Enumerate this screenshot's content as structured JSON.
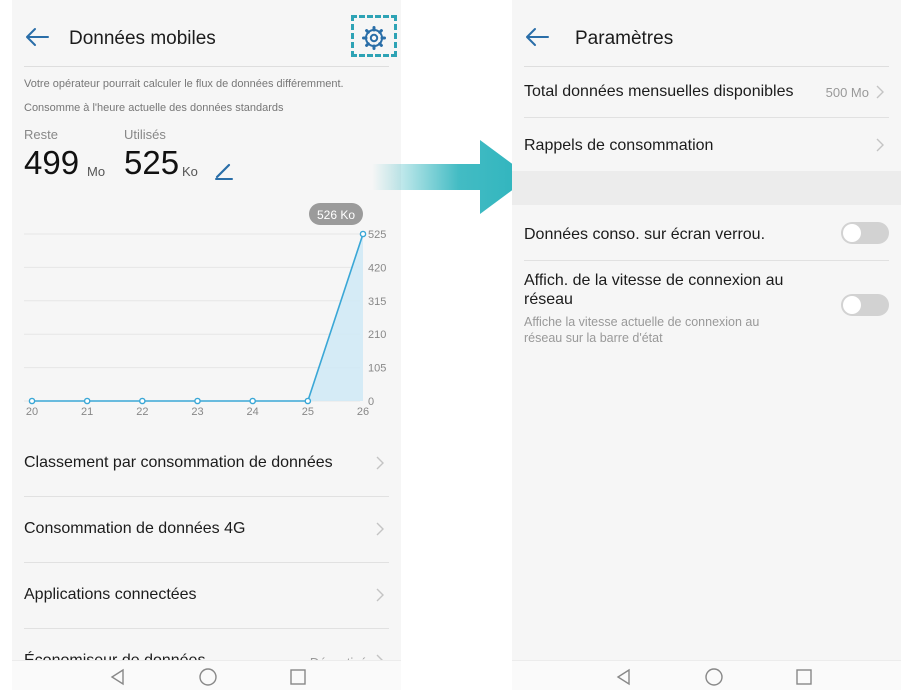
{
  "left": {
    "title": "Données mobiles",
    "note1": "Votre opérateur pourrait calculer le flux de données différemment.",
    "note2": "Consomme à l'heure actuelle des données standards",
    "remaining_label": "Reste",
    "remaining_value": "499",
    "remaining_unit": "Mo",
    "used_label": "Utilisés",
    "used_value": "525",
    "used_unit": "Ko",
    "rows": [
      {
        "label": "Classement par consommation de données"
      },
      {
        "label": "Consommation de données 4G"
      },
      {
        "label": "Applications connectées"
      },
      {
        "label": "Économiseur de données",
        "value": "Désactivé"
      }
    ]
  },
  "right": {
    "title": "Paramètres",
    "rows": [
      {
        "label": "Total données mensuelles disponibles",
        "value": "500 Mo"
      },
      {
        "label": "Rappels de consommation"
      }
    ],
    "lock_screen": {
      "label": "Données conso. sur écran verrou.",
      "on": false
    },
    "speed": {
      "label_line1": "Affich. de la vitesse de connexion au",
      "label_line2": "réseau",
      "desc_line1": "Affiche la vitesse actuelle de connexion au",
      "desc_line2": "réseau sur la barre d'état",
      "on": false
    }
  },
  "icons": [
    "back-icon",
    "gear-icon",
    "edit-icon",
    "chevron-right-icon",
    "nav-back-icon",
    "nav-home-icon",
    "nav-recent-icon"
  ],
  "colors": {
    "accent": "#2ea3b5",
    "chart_line": "#3aa7d6",
    "chart_fill": "#cfe9f6"
  },
  "chart_data": {
    "type": "area",
    "x": [
      20,
      21,
      22,
      23,
      24,
      25,
      26
    ],
    "values": [
      0,
      0,
      0,
      0,
      0,
      0,
      525
    ],
    "tooltip": "526 Ko",
    "y_ticks": [
      525,
      420,
      315,
      210,
      105,
      0
    ],
    "ylim": [
      0,
      525
    ],
    "grid": true
  }
}
